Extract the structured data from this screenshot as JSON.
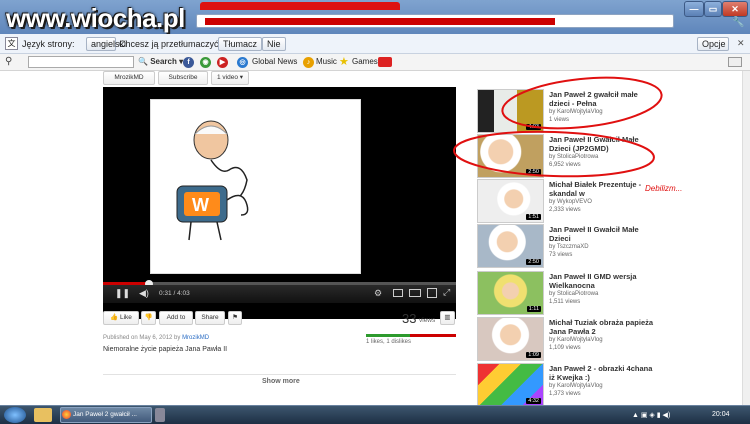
{
  "watermark": "www.wiocha.pl",
  "window": {
    "min": "—",
    "max": "▭",
    "close": "✕"
  },
  "translate_bar": {
    "language_label": "Język strony:",
    "language_value": "angielski",
    "question": "Chcesz ją przetłumaczyć?",
    "translate_button": "Tłumacz",
    "no_button": "Nie",
    "options_button": "Opcje"
  },
  "toolbar": {
    "search_label": "Search",
    "global_news": "Global News",
    "music": "Music",
    "games": "Games"
  },
  "channel": {
    "name": "MrozikMD",
    "subscribe": "Subscribe",
    "video_count": "1 video"
  },
  "player": {
    "time": "0:31 / 4:03",
    "progress": 0.13
  },
  "actions": {
    "like": "Like",
    "add_to": "Add to",
    "share": "Share"
  },
  "stats": {
    "views": "33",
    "views_label": "views",
    "likes_text": "1 likes, 1 dislikes"
  },
  "meta": {
    "published": "Published on May 6, 2012 by",
    "author": "MrozikMD",
    "description": "Niemoralne życie papieża Jana Pawła II"
  },
  "show_more": "Show more",
  "annotation": "Debilizm...",
  "colors": {
    "annotation_red": "#e01010",
    "link_blue": "#2a6cc4",
    "like_green": "#2d9a2d",
    "dislike_red": "#cc0000"
  },
  "suggestions": [
    {
      "title": "Jan Paweł 2 gwałcił małe dzieci - Pełna",
      "by": "by KarolWojtylaVlog",
      "views": "1 views",
      "duration": "4:03"
    },
    {
      "title": "Jan Paweł II Gwałcił Małe Dzieci (JP2GMD)",
      "by": "by StolicaPiotrowa",
      "views": "6,952 views",
      "duration": "2:50"
    },
    {
      "title": "Michał Białek Prezentuje - skandal w",
      "by": "by WykopVEVO",
      "views": "2,333 views",
      "duration": "1:51"
    },
    {
      "title": "Jan Paweł II Gwałcił Małe Dzieci",
      "by": "by TszczmaXD",
      "views": "73 views",
      "duration": "2:50"
    },
    {
      "title": "Jan Paweł II GMD wersja Wielkanocna",
      "by": "by StolicaPiotrowa",
      "views": "1,511 views",
      "duration": "1:11"
    },
    {
      "title": "Michał Tuziak obraża papieża Jana Pawła 2",
      "by": "by KarolWojtylaVlog",
      "views": "1,109 views",
      "duration": "1:09"
    },
    {
      "title": "Jan Paweł 2 - obrazki 4chana iż Kwejka :)",
      "by": "by KarolWojtylaVlog",
      "views": "1,373 views",
      "duration": "4:32"
    }
  ],
  "taskbar": {
    "task_label": "Jan Paweł 2 gwałcił ...",
    "clock": "20:04"
  }
}
